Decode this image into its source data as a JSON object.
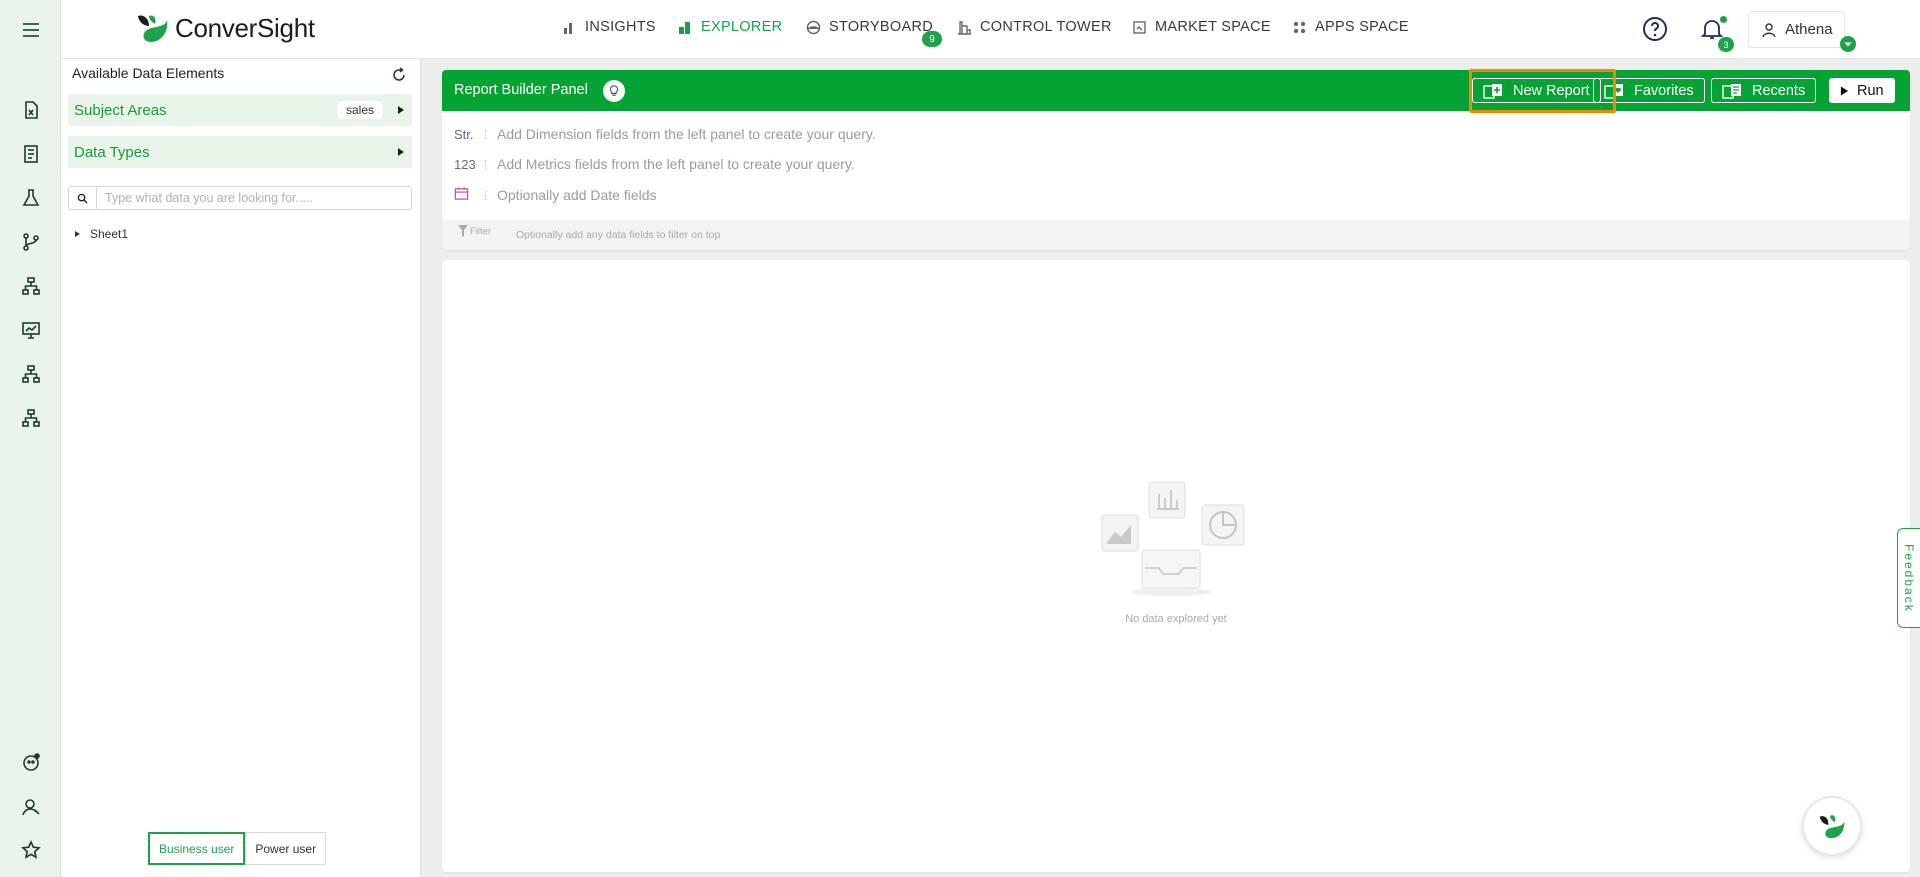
{
  "app": {
    "logo_text": "ConverSight"
  },
  "nav": {
    "items": [
      {
        "label": "INSIGHTS",
        "icon": "bar-chart-icon"
      },
      {
        "label": "EXPLORER",
        "icon": "explorer-chart-icon",
        "active": true
      },
      {
        "label": "STORYBOARD",
        "icon": "storyboard-icon"
      },
      {
        "label": "CONTROL TOWER",
        "icon": "tower-icon"
      },
      {
        "label": "MARKET SPACE",
        "icon": "market-icon"
      },
      {
        "label": "APPS SPACE",
        "icon": "apps-grid-icon"
      }
    ],
    "storyboard_badge": "9"
  },
  "header": {
    "notifications_count": "3",
    "user_name": "Athena"
  },
  "sidebar": {
    "title": "Available Data Elements",
    "subject_areas_label": "Subject Areas",
    "subject_area_value": "sales",
    "data_types_label": "Data Types",
    "search_placeholder": "Type what data you are looking for.....",
    "tree": [
      {
        "label": "Sheet1"
      }
    ],
    "user_modes": [
      {
        "label": "Business user",
        "active": true
      },
      {
        "label": "Power user",
        "active": false
      }
    ]
  },
  "report_builder": {
    "title": "Report Builder Panel",
    "buttons": {
      "new_report": "New Report",
      "favorites": "Favorites",
      "recents": "Recents",
      "run": "Run"
    },
    "rows": [
      {
        "tag": "Str.",
        "text": "Add Dimension fields from the left panel to create your query."
      },
      {
        "tag": "123",
        "text": "Add Metrics fields from the left panel to create your query."
      },
      {
        "tag": "calendar",
        "text": "Optionally add Date fields"
      }
    ],
    "filter_label": "Filter",
    "filter_hint": "Optionally add any data fields to filter on top"
  },
  "result": {
    "empty_text": "No data explored yet"
  },
  "feedback_label": "Feedback",
  "colors": {
    "brand_green": "#05a234",
    "highlight_orange": "#f08a00",
    "rail_bg": "#eaf4ea"
  }
}
